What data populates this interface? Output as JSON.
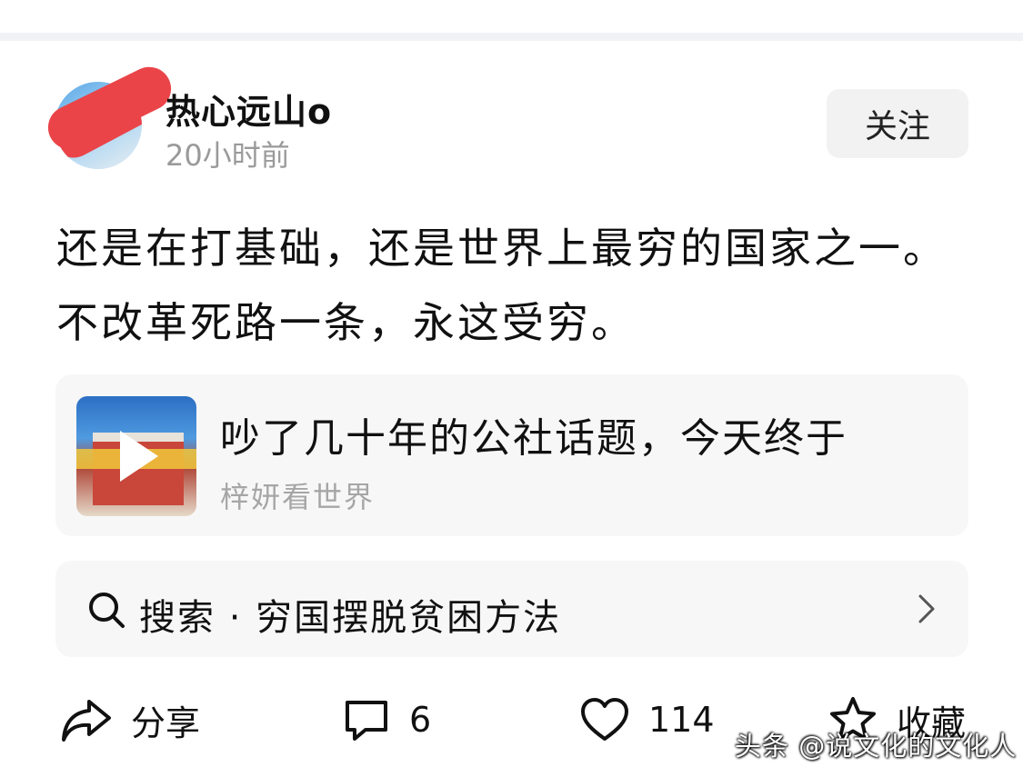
{
  "post": {
    "author": "热心远山o",
    "time": "20小时前",
    "follow_label": "关注",
    "text": "还是在打基础，还是世界上最穷的国家之一。不改革死路一条，永这受穷。"
  },
  "link_card": {
    "title": "吵了几十年的公社话题，今天终于",
    "source": "梓妍看世界",
    "thumbnail_icon": "play-icon"
  },
  "search": {
    "label": "搜索 · 穷国摆脱贫困方法",
    "icon": "search-icon"
  },
  "actions": {
    "share_label": "分享",
    "comment_count": "6",
    "like_count": "114",
    "favorite_label": "收藏"
  },
  "watermark": "头条 @说文化的文化人",
  "colors": {
    "redaction": "#ea4449",
    "card_background": "#f7f7f7",
    "secondary_text": "#9a9a9a"
  }
}
